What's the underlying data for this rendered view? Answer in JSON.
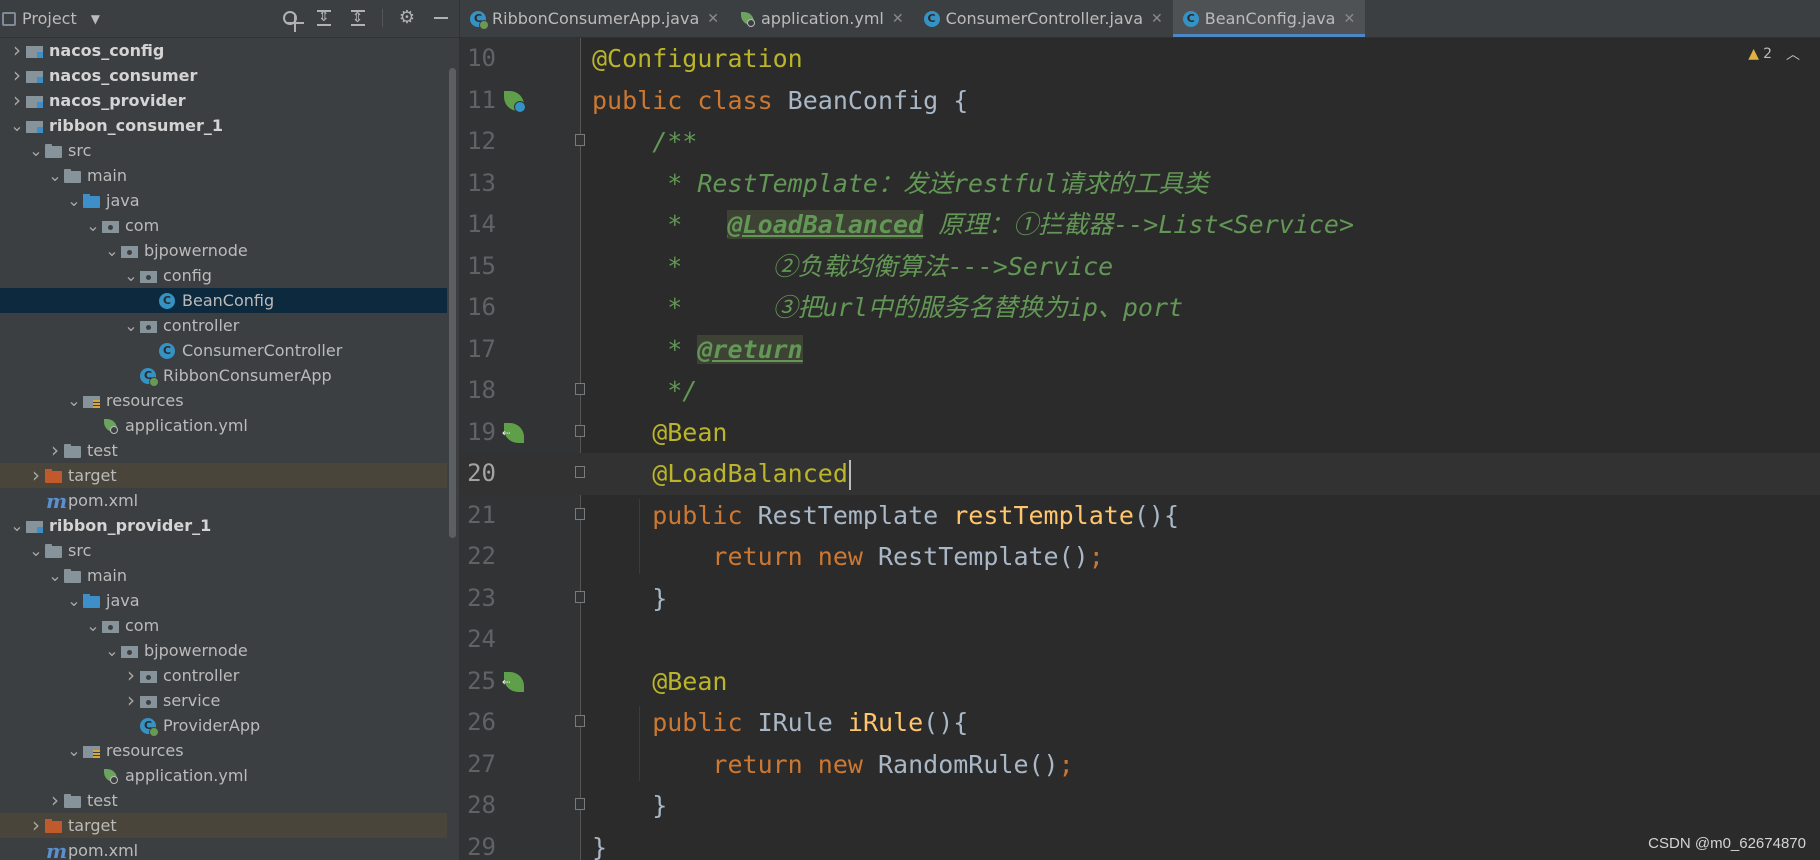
{
  "project": {
    "title": "Project",
    "tree": [
      {
        "label": "nacos_config",
        "depth": 0,
        "arrow": "right",
        "icon": "module-folder-icon",
        "bold": true
      },
      {
        "label": "nacos_consumer",
        "depth": 0,
        "arrow": "right",
        "icon": "module-folder-icon",
        "bold": true
      },
      {
        "label": "nacos_provider",
        "depth": 0,
        "arrow": "right",
        "icon": "module-folder-icon",
        "bold": true
      },
      {
        "label": "ribbon_consumer_1",
        "depth": 0,
        "arrow": "down",
        "icon": "module-folder-icon",
        "bold": true
      },
      {
        "label": "src",
        "depth": 1,
        "arrow": "down",
        "icon": "folder-icon"
      },
      {
        "label": "main",
        "depth": 2,
        "arrow": "down",
        "icon": "folder-icon"
      },
      {
        "label": "java",
        "depth": 3,
        "arrow": "down",
        "icon": "source-folder-icon"
      },
      {
        "label": "com",
        "depth": 4,
        "arrow": "down",
        "icon": "package-icon"
      },
      {
        "label": "bjpowernode",
        "depth": 5,
        "arrow": "down",
        "icon": "package-icon"
      },
      {
        "label": "config",
        "depth": 6,
        "arrow": "down",
        "icon": "package-icon"
      },
      {
        "label": "BeanConfig",
        "depth": 7,
        "arrow": "none",
        "icon": "class-icon",
        "selected": true
      },
      {
        "label": "controller",
        "depth": 6,
        "arrow": "down",
        "icon": "package-icon"
      },
      {
        "label": "ConsumerController",
        "depth": 7,
        "arrow": "none",
        "icon": "class-icon"
      },
      {
        "label": "RibbonConsumerApp",
        "depth": 6,
        "arrow": "none",
        "icon": "spring-boot-class-icon"
      },
      {
        "label": "resources",
        "depth": 3,
        "arrow": "down",
        "icon": "resources-folder-icon"
      },
      {
        "label": "application.yml",
        "depth": 4,
        "arrow": "none",
        "icon": "spring-yml-icon"
      },
      {
        "label": "test",
        "depth": 2,
        "arrow": "right",
        "icon": "folder-icon"
      },
      {
        "label": "target",
        "depth": 1,
        "arrow": "right",
        "icon": "excluded-folder-icon",
        "excluded": true
      },
      {
        "label": "pom.xml",
        "depth": 1,
        "arrow": "none",
        "icon": "maven-icon"
      },
      {
        "label": "ribbon_provider_1",
        "depth": 0,
        "arrow": "down",
        "icon": "module-folder-icon",
        "bold": true
      },
      {
        "label": "src",
        "depth": 1,
        "arrow": "down",
        "icon": "folder-icon"
      },
      {
        "label": "main",
        "depth": 2,
        "arrow": "down",
        "icon": "folder-icon"
      },
      {
        "label": "java",
        "depth": 3,
        "arrow": "down",
        "icon": "source-folder-icon"
      },
      {
        "label": "com",
        "depth": 4,
        "arrow": "down",
        "icon": "package-icon"
      },
      {
        "label": "bjpowernode",
        "depth": 5,
        "arrow": "down",
        "icon": "package-icon"
      },
      {
        "label": "controller",
        "depth": 6,
        "arrow": "right",
        "icon": "package-icon"
      },
      {
        "label": "service",
        "depth": 6,
        "arrow": "right",
        "icon": "package-icon"
      },
      {
        "label": "ProviderApp",
        "depth": 6,
        "arrow": "none",
        "icon": "spring-boot-class-icon"
      },
      {
        "label": "resources",
        "depth": 3,
        "arrow": "down",
        "icon": "resources-folder-icon"
      },
      {
        "label": "application.yml",
        "depth": 4,
        "arrow": "none",
        "icon": "spring-yml-icon"
      },
      {
        "label": "test",
        "depth": 2,
        "arrow": "right",
        "icon": "folder-icon"
      },
      {
        "label": "target",
        "depth": 1,
        "arrow": "right",
        "icon": "excluded-folder-icon",
        "excluded": true
      },
      {
        "label": "pom.xml",
        "depth": 1,
        "arrow": "none",
        "icon": "maven-icon"
      }
    ]
  },
  "tabs": [
    {
      "label": "RibbonConsumerApp.java",
      "icon": "spring-boot-class-icon",
      "active": false
    },
    {
      "label": "application.yml",
      "icon": "spring-yml-icon",
      "active": false
    },
    {
      "label": "ConsumerController.java",
      "icon": "class-icon",
      "active": false
    },
    {
      "label": "BeanConfig.java",
      "icon": "class-icon",
      "active": true
    }
  ],
  "editor": {
    "warning_count": "2",
    "current_line": 20,
    "lines": [
      {
        "num": "10",
        "tokens": [
          {
            "t": "@Configuration",
            "c": "ann"
          }
        ]
      },
      {
        "num": "11",
        "gutter": "bean-class-icon",
        "tokens": [
          {
            "t": "public class ",
            "c": "kw"
          },
          {
            "t": "BeanConfig {",
            "c": "cls"
          }
        ]
      },
      {
        "num": "12",
        "fold": true,
        "tokens": [
          {
            "t": "    /**",
            "c": "doc"
          }
        ]
      },
      {
        "num": "13",
        "tokens": [
          {
            "t": "     * RestTemplate：发送restful请求的工具类",
            "c": "doc"
          }
        ]
      },
      {
        "num": "14",
        "tokens": [
          {
            "t": "     *   ",
            "c": "doc"
          },
          {
            "t": "@LoadBalanced",
            "c": "doctag"
          },
          {
            "t": " 原理：①拦截器-->List<Service>",
            "c": "doc"
          }
        ]
      },
      {
        "num": "15",
        "tokens": [
          {
            "t": "     *      ②负载均衡算法--->Service",
            "c": "doc"
          }
        ]
      },
      {
        "num": "16",
        "tokens": [
          {
            "t": "     *      ③把url中的服务名替换为ip、port",
            "c": "doc"
          }
        ]
      },
      {
        "num": "17",
        "tokens": [
          {
            "t": "     * ",
            "c": "doc"
          },
          {
            "t": "@return",
            "c": "doctag"
          }
        ]
      },
      {
        "num": "18",
        "fold": true,
        "tokens": [
          {
            "t": "     */",
            "c": "doc"
          }
        ]
      },
      {
        "num": "19",
        "gutter": "bean-icon",
        "fold": true,
        "tokens": [
          {
            "t": "    @Bean",
            "c": "ann"
          }
        ]
      },
      {
        "num": "20",
        "fold": true,
        "caret": true,
        "tokens": [
          {
            "t": "    @LoadBalanced",
            "c": "ann"
          }
        ]
      },
      {
        "num": "21",
        "fold": true,
        "tokens": [
          {
            "t": "    public ",
            "c": "kw"
          },
          {
            "t": "RestTemplate ",
            "c": "cls"
          },
          {
            "t": "restTemplate",
            "c": "fn"
          },
          {
            "t": "(){",
            "c": "cls"
          }
        ]
      },
      {
        "num": "22",
        "tokens": [
          {
            "t": "        return new ",
            "c": "kw"
          },
          {
            "t": "RestTemplate()",
            "c": "cls"
          },
          {
            "t": ";",
            "c": "kw"
          }
        ]
      },
      {
        "num": "23",
        "fold": true,
        "tokens": [
          {
            "t": "    }",
            "c": "cls"
          }
        ]
      },
      {
        "num": "24",
        "tokens": []
      },
      {
        "num": "25",
        "gutter": "bean-icon",
        "tokens": [
          {
            "t": "    @Bean",
            "c": "ann"
          }
        ]
      },
      {
        "num": "26",
        "fold": true,
        "tokens": [
          {
            "t": "    public ",
            "c": "kw"
          },
          {
            "t": "IRule ",
            "c": "cls"
          },
          {
            "t": "iRule",
            "c": "fn"
          },
          {
            "t": "(){",
            "c": "cls"
          }
        ]
      },
      {
        "num": "27",
        "tokens": [
          {
            "t": "        return new ",
            "c": "kw"
          },
          {
            "t": "RandomRule()",
            "c": "cls"
          },
          {
            "t": ";",
            "c": "kw"
          }
        ]
      },
      {
        "num": "28",
        "fold": true,
        "tokens": [
          {
            "t": "    }",
            "c": "cls"
          }
        ]
      },
      {
        "num": "29",
        "tokens": [
          {
            "t": "}",
            "c": "cls"
          }
        ]
      }
    ]
  },
  "watermark": "CSDN @m0_62674870"
}
